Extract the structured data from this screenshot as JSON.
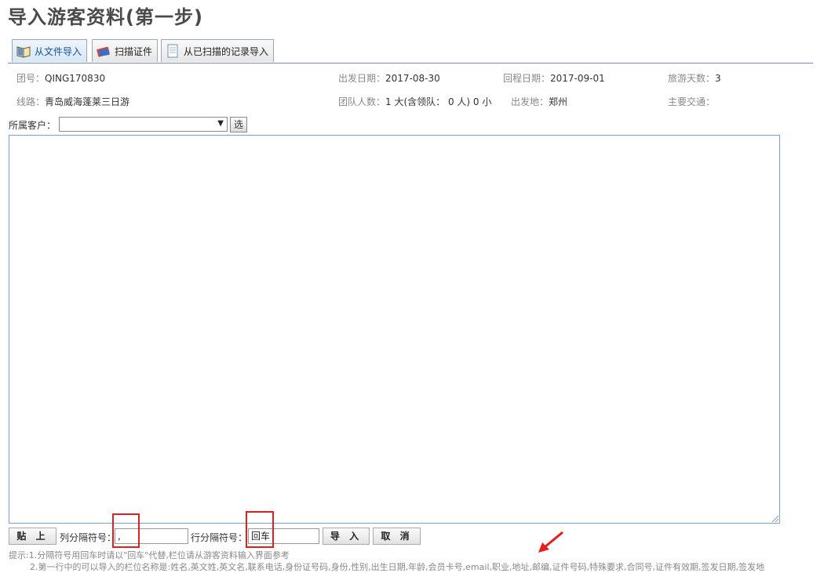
{
  "page": {
    "title": "导入游客资料(第一步)"
  },
  "tabs": [
    {
      "label": "从文件导入",
      "icon": "book-icon",
      "active": true
    },
    {
      "label": "扫描证件",
      "icon": "id-card-icon",
      "active": false
    },
    {
      "label": "从已扫描的记录导入",
      "icon": "document-icon",
      "active": false
    }
  ],
  "info": {
    "group_no_label": "团号：",
    "group_no": "QING170830",
    "depart_date_label": "出发日期：",
    "depart_date": "2017-08-30",
    "return_date_label": "回程日期：",
    "return_date": "2017-09-01",
    "days_label": "旅游天数：",
    "days": "3",
    "route_label": "线路：",
    "route": "青岛威海蓬莱三日游",
    "headcount_label": "团队人数：",
    "headcount": "1 大(含领队： 0 人) 0 小",
    "origin_label": "出发地：",
    "origin": "郑州",
    "transport_label": "主要交通："
  },
  "customer": {
    "label": "所属客户：",
    "value": "",
    "select_button": "选"
  },
  "import_text": "",
  "controls": {
    "paste_button": "贴 上",
    "col_sep_label": "列分隔符号：",
    "col_sep_value": ",",
    "row_sep_label": "行分隔符号：",
    "row_sep_value": "回车",
    "import_button": "导 入",
    "cancel_button": "取 消"
  },
  "hints": {
    "line1": "提示:1.分隔符号用回车时请以\"回车\"代替,栏位请从游客资料输入界面参考",
    "line2": "2.第一行中的可以导入的栏位名称是:姓名,英文姓,英文名,联系电话,身份证号码,身份,性别,出生日期,年龄,会员卡号,email,职业,地址,邮编,证件号码,特殊要求,合同号,证件有效期,签发日期,签发地"
  },
  "colors": {
    "accent": "#6f8fb4",
    "highlight": "#e0201d",
    "arrow": "#e0201d"
  }
}
